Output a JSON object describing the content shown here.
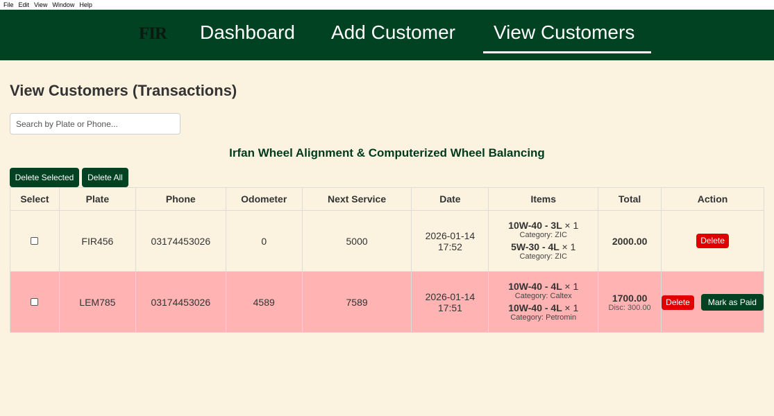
{
  "menu": {
    "file": "File",
    "edit": "Edit",
    "view": "View",
    "window": "Window",
    "help": "Help"
  },
  "nav": {
    "logo": "FIR",
    "dashboard": "Dashboard",
    "add_customer": "Add Customer",
    "view_customers": "View Customers"
  },
  "page": {
    "title": "View Customers (Transactions)",
    "search_placeholder": "Search by Plate or Phone...",
    "business_name": "Irfan Wheel Alignment & Computerized Wheel Balancing",
    "delete_selected": "Delete Selected",
    "delete_all": "Delete All"
  },
  "table": {
    "headers": {
      "select": "Select",
      "plate": "Plate",
      "phone": "Phone",
      "odometer": "Odometer",
      "next_service": "Next Service",
      "date": "Date",
      "items": "Items",
      "total": "Total",
      "action": "Action"
    },
    "rows": [
      {
        "plate": "FIR456",
        "phone": "03174453026",
        "odometer": "0",
        "next_service": "5000",
        "date": "2026-01-14",
        "time": "17:52",
        "items": [
          {
            "name": "10W-40 - 3L",
            "qty": "× 1",
            "category": "Category: ZIC"
          },
          {
            "name": "5W-30 - 4L",
            "qty": "× 1",
            "category": "Category: ZIC"
          }
        ],
        "total": "2000.00",
        "discount": "",
        "delete_label": "Delete",
        "paid_label": ""
      },
      {
        "plate": "LEM785",
        "phone": "03174453026",
        "odometer": "4589",
        "next_service": "7589",
        "date": "2026-01-14",
        "time": "17:51",
        "items": [
          {
            "name": "10W-40 - 4L",
            "qty": "× 1",
            "category": "Category: Caltex"
          },
          {
            "name": "10W-40 - 4L",
            "qty": "× 1",
            "category": "Category: Petromin"
          }
        ],
        "total": "1700.00",
        "discount": "Disc: 300.00",
        "delete_label": "Delete",
        "paid_label": "Mark as Paid"
      }
    ]
  },
  "colors": {
    "nav_bg": "#004221",
    "page_bg": "#fbf2e0",
    "unpaid_row": "#ffb3b3",
    "delete_red": "#e00000"
  }
}
